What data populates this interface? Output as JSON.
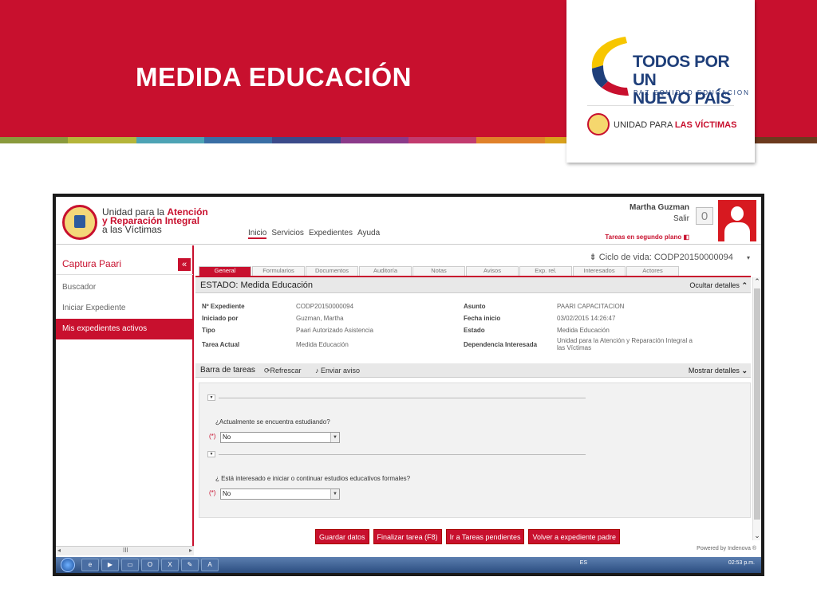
{
  "slide": {
    "title": "MEDIDA EDUCACIÓN",
    "strip_colors": [
      "#8a9a3c",
      "#b5b53a",
      "#4da3b5",
      "#3a6ea5",
      "#3b4a8a",
      "#8b3a8a",
      "#c23b6e",
      "#e0812a",
      "#d9a11c",
      "#c8102e",
      "#9b1b2a",
      "#6c3a1e"
    ],
    "logo": {
      "line1": "TODOS POR UN",
      "line2": "NUEVO PAÍS",
      "tagline": "PAZ EQUIDAD EDUCACION",
      "unidad_prefix": "UNIDAD PARA ",
      "unidad_bold": "LAS VÍCTIMAS"
    }
  },
  "app": {
    "logo_text": {
      "line1a": "Unidad para la ",
      "line1b": "Atención",
      "line2": "y Reparación Integral",
      "line3": "a las Víctimas"
    },
    "nav": [
      "Inicio",
      "Servicios",
      "Expedientes",
      "Ayuda"
    ],
    "user": {
      "name": "Martha Guzman",
      "logout": "Salir",
      "counter": "0",
      "background_tasks": "Tareas en segundo plano"
    },
    "sidebar": {
      "title": "Captura Paari",
      "collapse": "«",
      "items": [
        "Buscador",
        "Iniciar Expediente",
        "Mis expedientes activos"
      ],
      "scroll_grip": "III"
    },
    "lifecycle": "Ciclo de vida: CODP20150000094",
    "tabs": [
      "General",
      "Formularios",
      "Documentos",
      "Auditoría",
      "Notas",
      "Avisos",
      "Exp. rel.",
      "Interesados",
      "Actores"
    ],
    "estado": {
      "title": "ESTADO: Medida Educación",
      "toggle": "Ocultar detalles"
    },
    "details": {
      "labels": [
        "Nº Expediente",
        "Iniciado por",
        "Tipo",
        "Tarea Actual"
      ],
      "values": [
        "CODP20150000094",
        "Guzman, Martha",
        "Paari Autorizado Asistencia",
        "Medida Educación"
      ],
      "labels_right": [
        "Asunto",
        "Fecha inicio",
        "Estado",
        "Dependencia Interesada"
      ],
      "values_right": [
        "PAARI CAPACITACION",
        "03/02/2015 14:26:47",
        "Medida Educación",
        "Unidad para la Atención y Reparación Integral a las Víctimas"
      ]
    },
    "barra": {
      "title": "Barra de tareas",
      "refresh": "Refrescar",
      "notify": "Enviar aviso",
      "toggle": "Mostrar detalles"
    },
    "form": {
      "q1": "¿Actualmente se encuentra estudiando?",
      "a1": "No",
      "q2": "¿ Está interesado e iniciar o continuar estudios educativos formales?",
      "a2": "No",
      "required": "(*)"
    },
    "buttons": [
      "Guardar datos",
      "Finalizar tarea (F8)",
      "Ir a Tareas pendientes",
      "Volver a expediente padre"
    ],
    "powered": "Powered by Indenova ®"
  },
  "taskbar": {
    "lang": "ES",
    "clock": "02:53 p.m."
  }
}
